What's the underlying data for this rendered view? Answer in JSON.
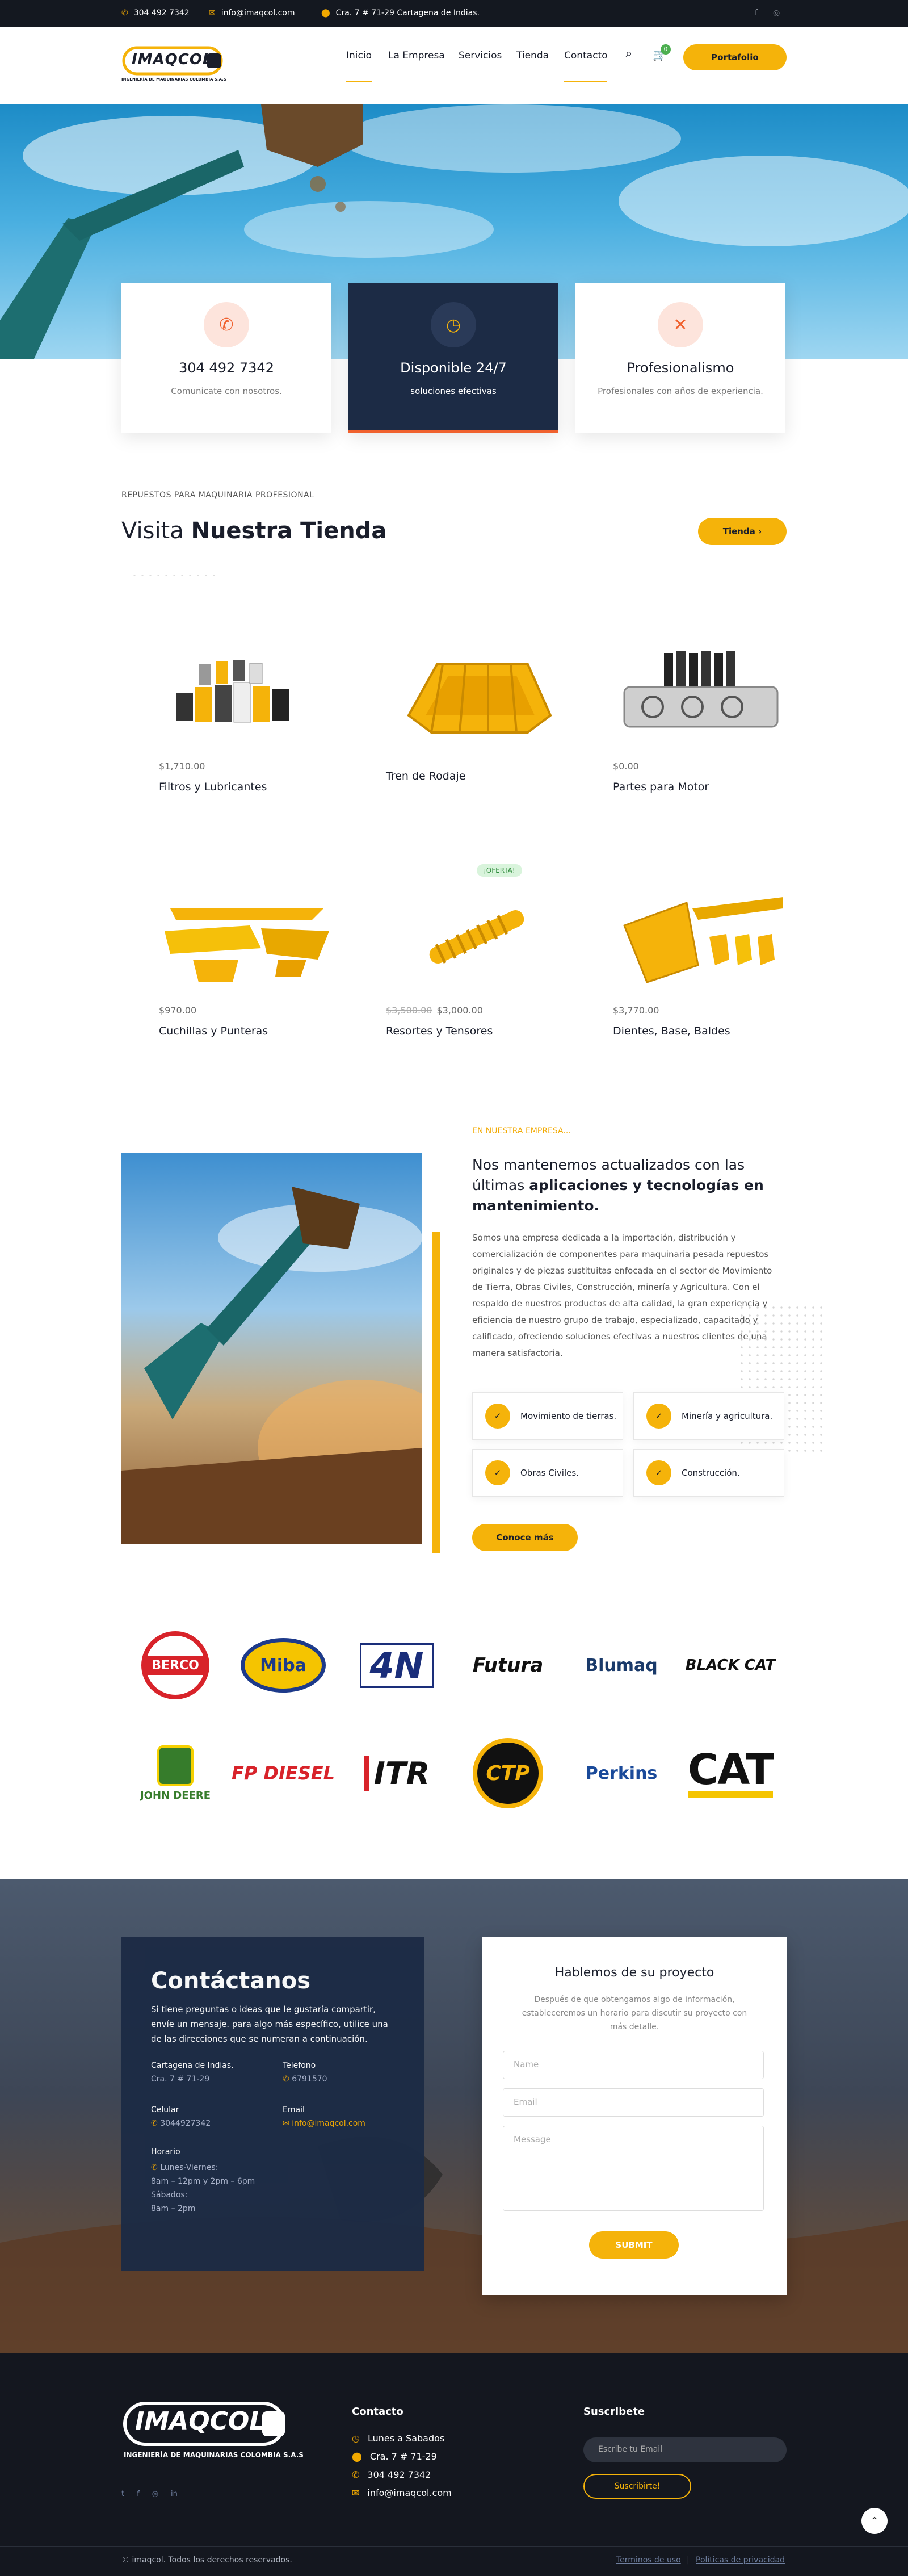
{
  "topbar": {
    "phone": "304 492 7342",
    "email": "info@imaqcol.com",
    "address": "Cra. 7 # 71-29 Cartagena de Indias."
  },
  "logo": {
    "name": "IMAQCOL",
    "tagline": "INGENIERÍA DE MAQUINARIAS COLOMBIA S.A.S"
  },
  "nav": {
    "items": [
      "Inicio",
      "La Empresa",
      "Servicios",
      "Tienda",
      "Contacto"
    ],
    "cart_count": "0",
    "cta": "Portafolio"
  },
  "cards": [
    {
      "title": "304 492 7342",
      "text": "Comunicate con nosotros."
    },
    {
      "title": "Disponible 24/7",
      "text": "soluciones efectivas"
    },
    {
      "title": "Profesionalismo",
      "text": "Profesionales con años de experiencia."
    }
  ],
  "shop": {
    "eyebrow": "REPUESTOS PARA MAQUINARIA PROFESIONAL",
    "title_a": "Visita ",
    "title_b": "Nuestra Tienda",
    "button": "Tienda ›"
  },
  "products": [
    {
      "price": "$1,710.00",
      "name": "Filtros y Lubricantes"
    },
    {
      "price": "",
      "name": "Tren de Rodaje"
    },
    {
      "price": "$0.00",
      "name": "Partes para Motor"
    },
    {
      "price": "$970.00",
      "name": "Cuchillas y Punteras"
    },
    {
      "price": "$3,000.00",
      "old_price": "$3,500.00",
      "badge": "¡OFERTA!",
      "name": "Resortes y Tensores"
    },
    {
      "price": "$3,770.00",
      "name": "Dientes, Base, Baldes"
    }
  ],
  "about": {
    "eyebrow": "EN NUESTRA EMPRESA...",
    "title_a": "Nos mantenemos actualizados con las últimas ",
    "title_b": "aplicaciones y tecnologías en mantenimiento.",
    "body": "Somos una empresa dedicada a la importación, distribución y comercialización de componentes para maquinaria pesada repuestos originales y de piezas sustituitas enfocada en el sector de Movimiento de Tierra, Obras Civiles, Construcción, minería y Agricultura. Con el respaldo de nuestros productos de alta calidad, la gran experiencia y eficiencia de nuestro grupo de trabajo, especializado, capacitado y calificado, ofreciendo soluciones efectivas a nuestros clientes de una manera satisfactoria.",
    "features": [
      "Movimiento de tierras.",
      "Minería y agricultura.",
      "Obras Civiles.",
      "Construcción."
    ],
    "button": "Conoce más"
  },
  "brands": [
    "BERCO",
    "Miba",
    "4N",
    "Futura",
    "Blumaq",
    "BLACK CAT",
    "JOHN DEERE",
    "FP DIESEL",
    "ITR",
    "CTP",
    "Perkins",
    "CAT"
  ],
  "contact": {
    "title": "Contáctanos",
    "intro": "Si tiene preguntas o ideas que le gustaría compartir, envíe un mensaje. para algo más específico, utilice una de las direcciones que se numeran a continuación.",
    "city_label": "Cartagena de Indias.",
    "city_value": "Cra. 7 # 71-29",
    "phone_label": "Telefono",
    "phone_value": "6791570",
    "mobile_label": "Celular",
    "mobile_value": "3044927342",
    "email_label": "Email",
    "email_value": "info@imaqcol.com",
    "hours_label": "Horario",
    "hours_1": "Lunes-Viernes:",
    "hours_2": "8am – 12pm y 2pm – 6pm",
    "hours_3": "Sábados:",
    "hours_4": "8am – 2pm",
    "form_title": "Hablemos de su proyecto",
    "form_text": "Después de que obtengamos algo de información, estableceremos un horario para discutir su proyecto con más detalle.",
    "name_ph": "Name",
    "email_ph": "Email",
    "msg_ph": "Message",
    "submit": "SUBMIT"
  },
  "footer": {
    "contact_title": "Contacto",
    "days": "Lunes a Sabados",
    "address": "Cra. 7 # 71-29",
    "phone": "304 492 7342",
    "email": "info@imaqcol.com",
    "sub_title": "Suscribete",
    "sub_ph": "Escribe tu Email",
    "sub_btn": "Suscribirte!",
    "copyright": "© imaqcol. Todos los derechos reservados.",
    "terms": "Terminos de uso",
    "privacy": "Políticas de privacidad"
  },
  "colors": {
    "accent": "#f5b30a",
    "dark": "#141820",
    "navy": "#1c2b45"
  }
}
